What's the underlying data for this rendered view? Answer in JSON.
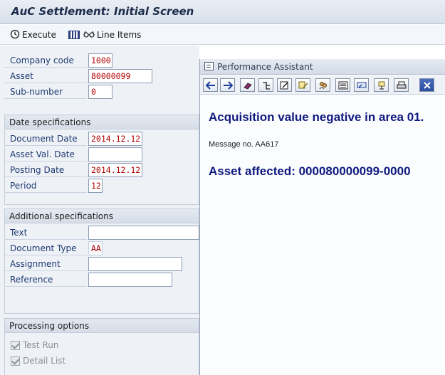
{
  "title": "AuC Settlement: Initial Screen",
  "toolbar": {
    "execute_label": "Execute",
    "line_items_label": "Line Items"
  },
  "header_fields": [
    {
      "label": "Company code",
      "value": "1000"
    },
    {
      "label": "Asset",
      "value": "80000099"
    },
    {
      "label": "Sub-number",
      "value": "0"
    }
  ],
  "date_specifications": {
    "title": "Date specifications",
    "fields": [
      {
        "label": "Document Date",
        "value": "2014.12.12"
      },
      {
        "label": "Asset Val. Date",
        "value": ""
      },
      {
        "label": "Posting Date",
        "value": "2014.12.12"
      },
      {
        "label": "Period",
        "value": "12"
      }
    ]
  },
  "additional_specifications": {
    "title": "Additional specifications",
    "fields": [
      {
        "label": "Text",
        "value": ""
      },
      {
        "label": "Document Type",
        "value": "AA"
      },
      {
        "label": "Assignment",
        "value": ""
      },
      {
        "label": "Reference",
        "value": ""
      }
    ]
  },
  "processing_options": {
    "title": "Processing options",
    "checks": [
      {
        "label": "Test Run",
        "checked": true
      },
      {
        "label": "Detail List",
        "checked": true
      }
    ]
  },
  "performance_assistant": {
    "title": "Performance Assistant",
    "toolbar_icons": [
      "back-arrow-icon",
      "forward-arrow-icon",
      "book-icon",
      "structure-icon",
      "edit-icon",
      "notes-icon",
      "people-icon",
      "list-icon",
      "link-icon",
      "settings-icon",
      "print-icon",
      "close-icon"
    ],
    "message": "Acquisition value negative in area 01.",
    "message_no": "Message no. AA617",
    "asset_affected": "Asset affected: 000080000099-0000"
  },
  "colors": {
    "label_blue": "#1f3a70",
    "value_red": "#b00000",
    "message_navy": "#0e1a7e"
  }
}
